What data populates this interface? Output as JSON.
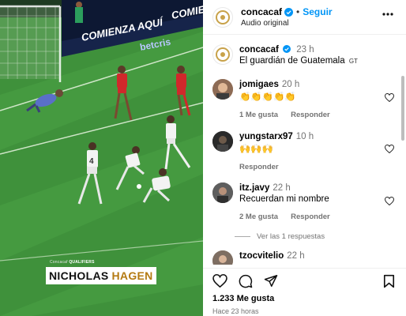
{
  "video": {
    "banner_left": "COMIENZA AQUÍ",
    "banner_right": "COMIENZA",
    "banner_brand": "betcris",
    "qualifier_brand": "Concacaf",
    "qualifier_label": "QUALIFIERS",
    "player_first_name": "NICHOLAS",
    "player_last_name": "HAGEN",
    "jersey_number": "4"
  },
  "header": {
    "username": "concacaf",
    "follow_label": "Seguir",
    "audio_label": "Audio original"
  },
  "caption": {
    "username": "concacaf",
    "time": "23 h",
    "text": "El guardián de Guatemala",
    "flag": "GT"
  },
  "comments": [
    {
      "username": "jomigaes",
      "time": "20 h",
      "text": "👏👏👏👏👏",
      "likes": "1 Me gusta",
      "reply": "Responder"
    },
    {
      "username": "yungstarx97",
      "time": "10 h",
      "text": "🙌🙌🙌",
      "reply": "Responder"
    },
    {
      "username": "itz.javy",
      "time": "22 h",
      "text": "Recuerdan mi nombre",
      "likes": "2 Me gusta",
      "reply": "Responder",
      "view_replies": "Ver las 1 respuestas"
    },
    {
      "username": "tzocvitelio",
      "time": "22 h"
    }
  ],
  "footer": {
    "likes": "1.233 Me gusta",
    "posted": "Hace 23 horas"
  },
  "colors": {
    "accent": "#0095f6",
    "pitch": "#3e8f3a",
    "muted": "#737373",
    "red_team": "#d0282b"
  }
}
